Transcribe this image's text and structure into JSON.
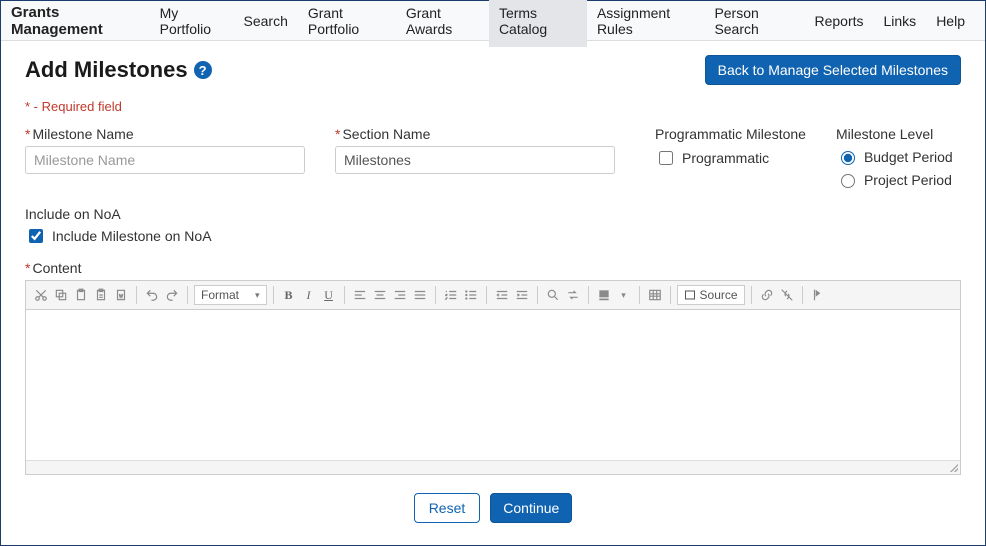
{
  "nav": {
    "brand": "Grants Management",
    "items": [
      {
        "label": "My Portfolio",
        "active": false
      },
      {
        "label": "Search",
        "active": false
      },
      {
        "label": "Grant Portfolio",
        "active": false
      },
      {
        "label": "Grant Awards",
        "active": false
      },
      {
        "label": "Terms Catalog",
        "active": true
      },
      {
        "label": "Assignment Rules",
        "active": false
      },
      {
        "label": "Person Search",
        "active": false
      },
      {
        "label": "Reports",
        "active": false
      },
      {
        "label": "Links",
        "active": false
      },
      {
        "label": "Help",
        "active": false
      }
    ]
  },
  "page": {
    "title": "Add Milestones",
    "back_button": "Back to Manage Selected Milestones",
    "required_note": "* - Required field"
  },
  "form": {
    "milestone_name": {
      "label": "Milestone Name",
      "placeholder": "Milestone Name",
      "value": ""
    },
    "section_name": {
      "label": "Section Name",
      "value": "Milestones"
    },
    "programmatic": {
      "group_label": "Programmatic Milestone",
      "label": "Programmatic",
      "checked": false
    },
    "milestone_level": {
      "group_label": "Milestone Level",
      "options": [
        {
          "label": "Budget Period",
          "checked": true
        },
        {
          "label": "Project Period",
          "checked": false
        }
      ]
    },
    "include_noa": {
      "group_label": "Include on NoA",
      "label": "Include Milestone on NoA",
      "checked": true
    },
    "content_label": "Content"
  },
  "editor": {
    "format_label": "Format",
    "source_label": "Source"
  },
  "actions": {
    "reset": "Reset",
    "continue": "Continue"
  }
}
